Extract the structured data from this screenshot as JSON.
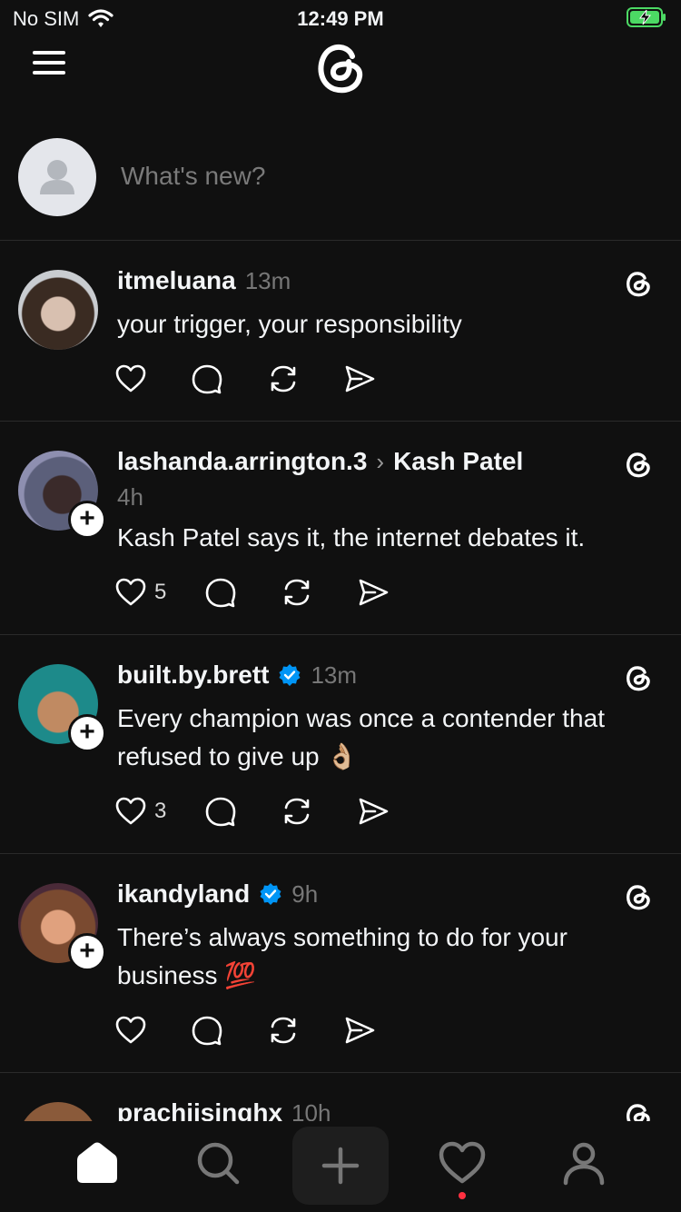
{
  "status": {
    "carrier": "No SIM",
    "time": "12:49 PM"
  },
  "composer": {
    "placeholder": "What's new?"
  },
  "posts": [
    {
      "username": "itmeluana",
      "time": "13m",
      "text": "your trigger, your responsibility",
      "like_count": ""
    },
    {
      "username": "lashanda.arrington.3",
      "reply_arrow": "›",
      "reply_to": "Kash Patel",
      "time": "4h",
      "text": "Kash Patel says it, the internet debates it.",
      "like_count": "5"
    },
    {
      "username": "built.by.brett",
      "time": "13m",
      "text": "Every champion was once a contender that refused to give up 👌🏼",
      "like_count": "3",
      "verified": true
    },
    {
      "username": "ikandyland",
      "time": "9h",
      "text": "There’s always something to do for your business 💯",
      "like_count": "",
      "verified": true
    },
    {
      "username": "prachiisinghx",
      "time": "10h"
    }
  ],
  "colors": {
    "background": "#101010",
    "text": "#f3f5f7",
    "muted": "#777777",
    "verified": "#0095f6",
    "notification_dot": "#ff3040"
  },
  "icons": [
    "menu-icon",
    "threads-logo",
    "heart-icon",
    "comment-icon",
    "repost-icon",
    "share-icon",
    "home-icon",
    "search-icon",
    "plus-icon",
    "activity-heart-icon",
    "profile-icon"
  ]
}
